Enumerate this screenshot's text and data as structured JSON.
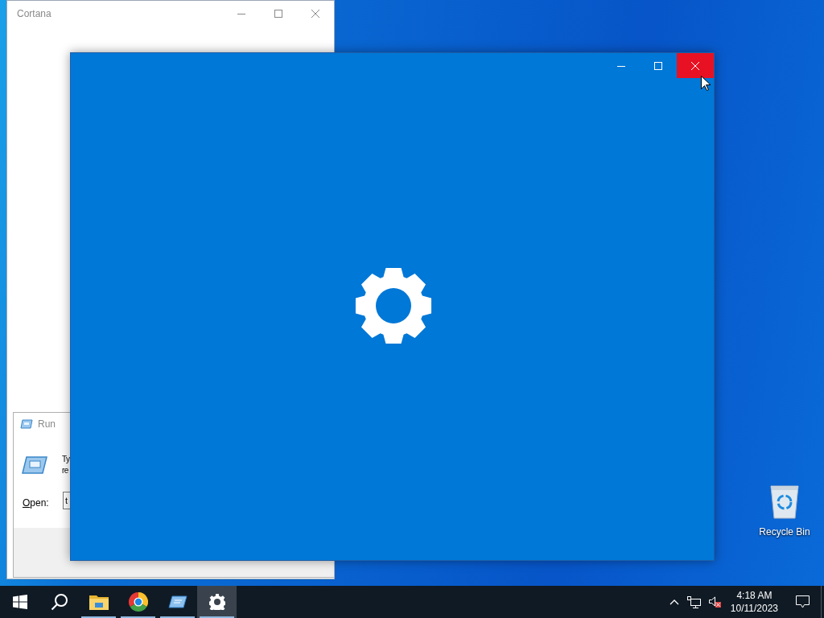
{
  "cortana_window": {
    "title": "Cortana"
  },
  "run_dialog": {
    "title": "Run",
    "description_lines": [
      "Ty",
      "re"
    ],
    "open_label": "Open:",
    "open_value": "t"
  },
  "settings_window": {
    "close_hovered": true
  },
  "desktop_icons": [
    {
      "label": "Recycle Bin"
    }
  ],
  "taskbar": {
    "apps": [
      {
        "kind": "start",
        "running": false,
        "selected": false
      },
      {
        "kind": "search",
        "running": false,
        "selected": false
      },
      {
        "kind": "explorer",
        "running": true,
        "selected": false
      },
      {
        "kind": "chrome",
        "running": true,
        "selected": false
      },
      {
        "kind": "run",
        "running": true,
        "selected": false
      },
      {
        "kind": "settings",
        "running": true,
        "selected": true
      }
    ],
    "time": "4:18 AM",
    "date": "10/11/2023"
  }
}
